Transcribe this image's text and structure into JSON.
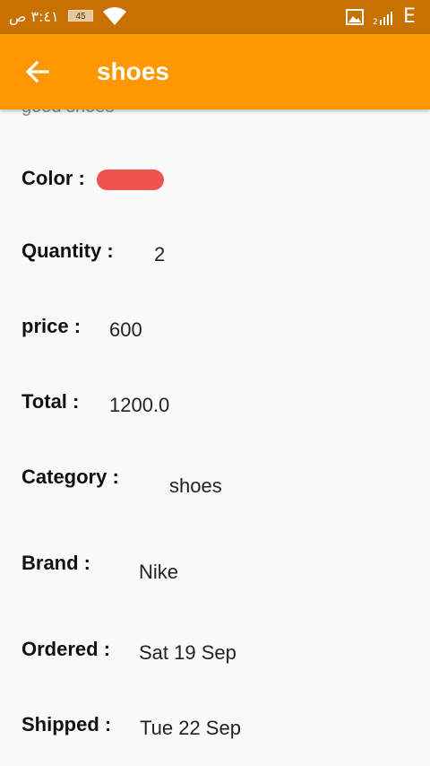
{
  "status_bar": {
    "time": "٣:٤١ ص",
    "battery": "45",
    "network_type": "E",
    "icons": [
      "wifi-icon",
      "gallery-icon",
      "signal-icon"
    ]
  },
  "app_bar": {
    "title": "shoes",
    "back_icon": "arrow-left-icon"
  },
  "description": "good shoes",
  "details": {
    "color": {
      "label": "Color  :",
      "swatch_color": "#ef5350"
    },
    "quantity": {
      "label": "Quantity  :",
      "value": "2"
    },
    "price": {
      "label": "price  :",
      "value": "600"
    },
    "total": {
      "label": "Total  :",
      "value": "1200.0"
    },
    "category": {
      "label": "Category  :",
      "value": "shoes"
    },
    "brand": {
      "label": "Brand  :",
      "value": "Nike"
    },
    "ordered": {
      "label": "Ordered  :",
      "value": "Sat 19 Sep"
    },
    "shipped": {
      "label": "Shipped  :",
      "value": "Tue 22 Sep"
    }
  },
  "colors": {
    "status_bar": "#c77100",
    "app_bar": "#ff9800",
    "background": "#fafafa"
  }
}
